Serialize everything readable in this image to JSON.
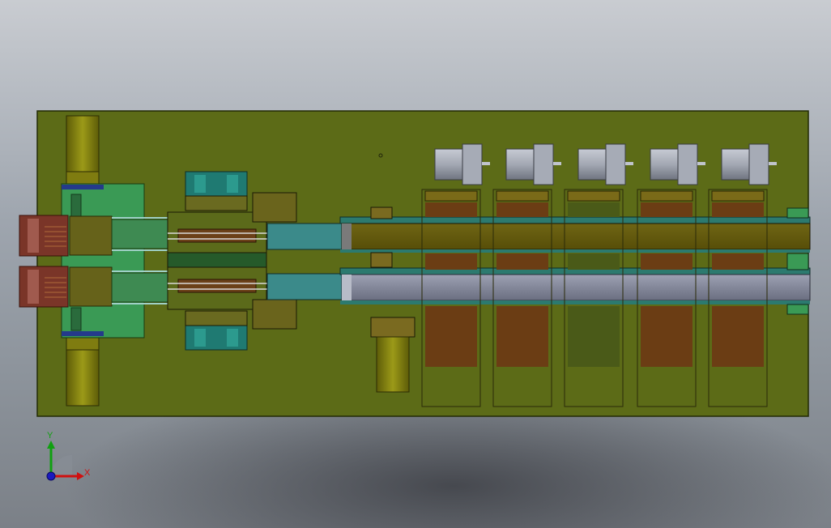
{
  "window": {
    "title": ""
  },
  "colors": {
    "background_top": "#c9ccd1",
    "background_bottom": "#7b8087",
    "base_plate": "#5c6b17",
    "base_plate_edge": "#222a05",
    "conveyor_upper": "#6e6214",
    "conveyor_lower": "#7a7f93",
    "rail": "#2c7a6f",
    "panel_green": "#3a9a55",
    "brown_block": "#6b3d14",
    "motor": "#9ba0ac",
    "cylinder": "#8b8b12",
    "axis_x": "#d01010",
    "axis_y": "#10a010",
    "axis_z": "#1a1ac0"
  },
  "triad": {
    "x_label": "X",
    "y_label": "Y"
  },
  "drive_motors": [
    {
      "id": 1,
      "icon": "stepper-motor-icon"
    },
    {
      "id": 2,
      "icon": "stepper-motor-icon"
    },
    {
      "id": 3,
      "icon": "stepper-motor-icon"
    },
    {
      "id": 4,
      "icon": "stepper-motor-icon"
    },
    {
      "id": 5,
      "icon": "stepper-motor-icon"
    }
  ]
}
